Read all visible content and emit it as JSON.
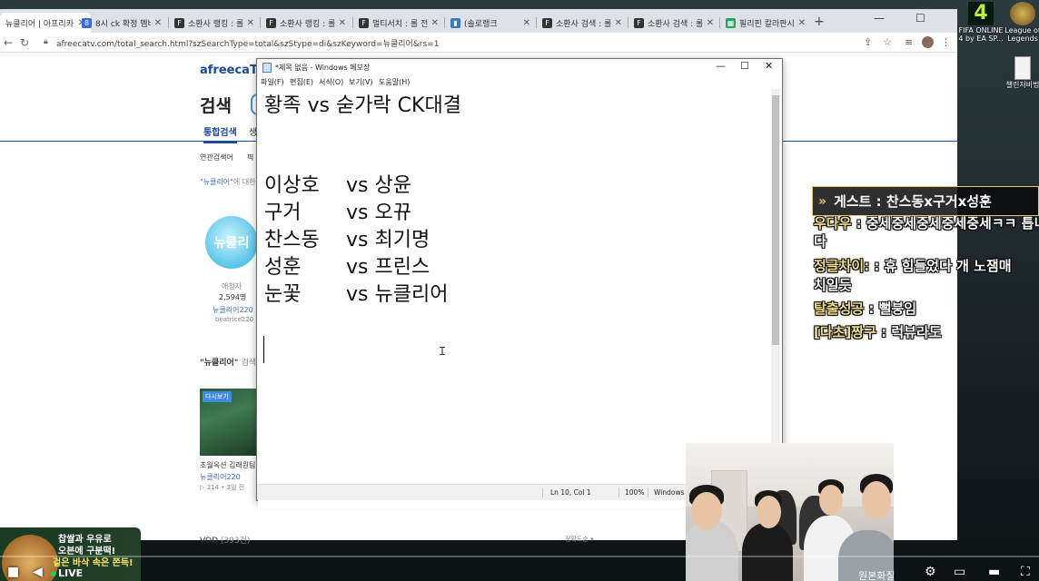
{
  "browser": {
    "tabs": [
      {
        "title": "뉴클리어 | 아프리카",
        "fav": "",
        "favColor": "#ffffff"
      },
      {
        "title": "8시 ck 확정 멤버",
        "fav": "",
        "favColor": "#3b6ad6"
      },
      {
        "title": "소환사 랭킹 : 롤",
        "fav": "F",
        "favColor": "#333333"
      },
      {
        "title": "소환사 랭킹 : 롤",
        "fav": "F",
        "favColor": "#333333"
      },
      {
        "title": "멀티서치 : 롤 전적",
        "fav": "F",
        "favColor": "#333333"
      },
      {
        "title": "(솔로랭크",
        "fav": "",
        "favColor": "#3478c6"
      },
      {
        "title": "소환사 검색 : 롤",
        "fav": "F",
        "favColor": "#333333"
      },
      {
        "title": "소환사 검색 : 롤",
        "fav": "F",
        "favColor": "#333333"
      },
      {
        "title": "필리핀 칼라판시티",
        "fav": "",
        "favColor": "#21a464"
      }
    ],
    "url": "afreecatv.com/total_search.html?szSearchType=total&szStype=di&szKeyword=뉴클리어&rs=1"
  },
  "page": {
    "logo": "afreecaTV",
    "title": "검색",
    "tabs": [
      "통합검색",
      "생"
    ],
    "related_label": "연관검색어",
    "related_next": "펵",
    "result_note_prefix": "\"뉴클리어\"",
    "result_note_suffix": "에 대한 결",
    "profile_text": "뉴클리",
    "fans_label": "애청자",
    "fans_count": "2,594명",
    "channel_name": "뉴클리어220",
    "channel_id": "beatrice220",
    "section_title_q": "\"뉴클리어\"",
    "section_title_rest": "검색",
    "replay_badge": "다시보기",
    "video_title": "초월옥션 김래원팀 초",
    "video_channel": "뉴클리어220",
    "video_meta": "▷ 214 • 3일 전",
    "vod_label": "VOD",
    "vod_count": "(393건)",
    "sort_label": "정확도순"
  },
  "notepad": {
    "title": "*제목 없음 - Windows 메모장",
    "menu": [
      "파일(F)",
      "편집(E)",
      "서식(O)",
      "보기(V)",
      "도움말(H)"
    ],
    "heading": "황족 vs 숟가락 CK대결",
    "matchups": [
      {
        "left": "이상호",
        "right": "vs 상윤"
      },
      {
        "left": "구거",
        "right": "vs 오뀨"
      },
      {
        "left": "찬스동",
        "right": "vs 최기명"
      },
      {
        "left": "성훈",
        "right": "vs 프린스"
      },
      {
        "left": "눈꽃",
        "right": "vs 뉴클리어"
      }
    ],
    "status": {
      "position": "Ln 10, Col 1",
      "zoom": "100%",
      "eol": "Windows ("
    }
  },
  "desktop": {
    "icons": [
      {
        "label": "FIFA ONLINE 4 by EA SP..."
      },
      {
        "label": "League of Legends"
      },
      {
        "label": "챌린저비법"
      }
    ]
  },
  "chat": {
    "header": "게스트 : 찬스동x구거x성훈",
    "messages": [
      {
        "nick": "우다우",
        "text": " : 중세중세중세중세중세ㅋㅋ 틉니"
      },
      {
        "nick": "",
        "text": "다"
      },
      {
        "nick": "정글차이:",
        "text": " : 휴 힘들었다 개 노잼매"
      },
      {
        "nick": "",
        "text": "치일듯"
      },
      {
        "nick": "탈출성공",
        "text": " : 뻘붕임"
      },
      {
        "nick": "[다초]짱구",
        "text": " : 럭뷰라도"
      }
    ]
  },
  "ad": {
    "line1": "찹쌀과 우유로",
    "line2": "오븐에 구분떡!",
    "line3": "겉은 바삭 속은 쫀득!"
  },
  "player": {
    "live_label": "LIVE",
    "quality_label": "원본화질"
  }
}
